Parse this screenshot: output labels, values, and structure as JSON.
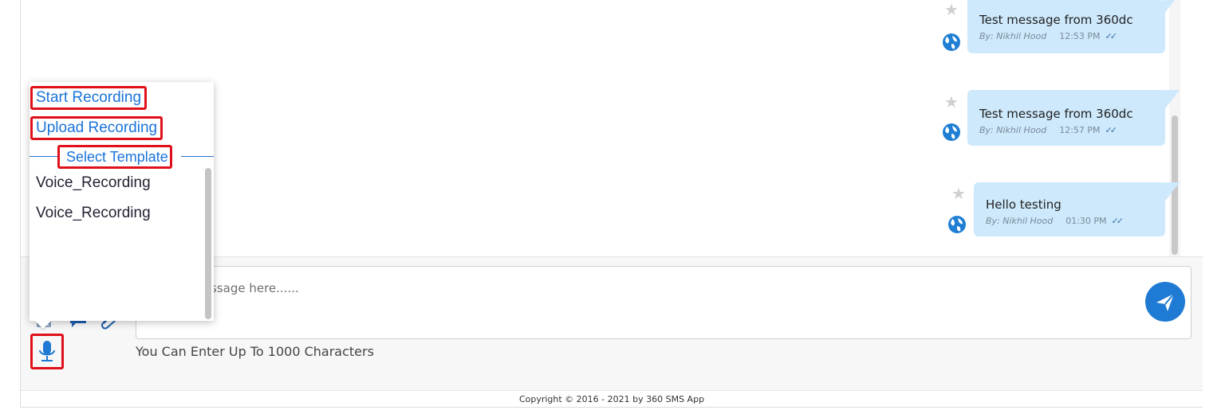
{
  "messages": [
    {
      "text": "Test message from 360dc",
      "author": "By: Nikhil Hood",
      "time": "12:53 PM"
    },
    {
      "text": "Test message from 360dc",
      "author": "By: Nikhil Hood",
      "time": "12:57 PM"
    },
    {
      "text": "Hello testing",
      "author": "By: Nikhil Hood",
      "time": "01:30 PM"
    }
  ],
  "composer": {
    "placeholder": "Type a message here......",
    "char_limit": "You Can Enter Up To 1000 Characters"
  },
  "recording_menu": {
    "start": "Start Recording",
    "upload": "Upload Recording",
    "section": "Select Template",
    "templates": [
      "Voice_Recording",
      "Voice_Recording"
    ]
  },
  "footer": {
    "copyright": "Copyright © 2016 - 2021 by 360 SMS App"
  },
  "icons": {
    "star": "star-icon",
    "globe": "globe-icon",
    "read": "double-check-icon",
    "send": "send-icon",
    "mic": "microphone-icon",
    "attach": "paperclip-icon",
    "chat": "chat-icon",
    "image": "image-icon"
  },
  "colors": {
    "accent": "#1e7ad3",
    "bubble": "#cde9fb",
    "highlight": "#e0101a"
  }
}
